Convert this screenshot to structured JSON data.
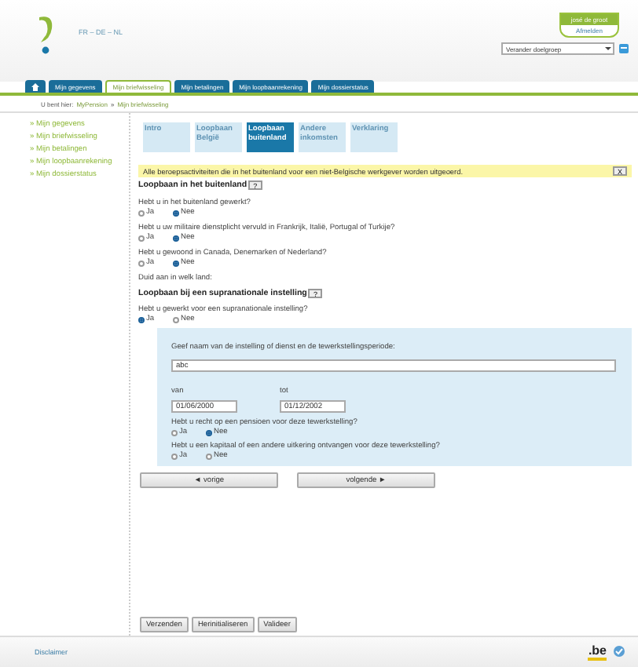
{
  "header": {
    "languages": "FR – DE – NL",
    "user": {
      "name": "josé de groot",
      "logout": "Afmelden"
    },
    "audience_select": {
      "value": "Verander doelgroep"
    }
  },
  "nav_tabs": [
    {
      "kind": "home",
      "selected": false
    },
    {
      "kind": "text",
      "label": "Mijn gegevens",
      "selected": false
    },
    {
      "kind": "text",
      "label": "Mijn briefwisseling",
      "selected": true
    },
    {
      "kind": "text",
      "label": "Mijn betalingen",
      "selected": false
    },
    {
      "kind": "text",
      "label": "Mijn loopbaanrekening",
      "selected": false
    },
    {
      "kind": "text",
      "label": "Mijn dossierstatus",
      "selected": false
    }
  ],
  "breadcrumb": {
    "prefix": "U bent hier:",
    "link": "MyPension",
    "separator": "»",
    "current": "Mijn briefwisseling"
  },
  "sidebar": {
    "items": [
      "» Mijn gegevens",
      "» Mijn briefwisseling",
      "» Mijn betalingen",
      "» Mijn loopbaanrekening",
      "» Mijn dossierstatus"
    ]
  },
  "steps": [
    {
      "label": "Intro",
      "selected": false
    },
    {
      "label": "Loopbaan België",
      "selected": false
    },
    {
      "label": "Loopbaan buitenland",
      "selected": true
    },
    {
      "label": "Andere inkomsten",
      "selected": false
    },
    {
      "label": "Verklaring",
      "selected": false
    }
  ],
  "notice": {
    "text": "Alle beroepsactiviteiten die in het buitenland voor een niet-Belgische werkgever worden uitgeoerd.",
    "close": "X"
  },
  "section_1": {
    "heading": "Loopbaan in het buitenland",
    "help": "?",
    "questions": [
      {
        "text": "Hebt u in het buitenland gewerkt?",
        "options": [
          {
            "label": "Ja",
            "selected": false
          },
          {
            "label": "Nee",
            "selected": true
          }
        ]
      },
      {
        "text": "Hebt u uw militaire dienstplicht vervuld in Frankrijk, Italië, Portugal of Turkije?",
        "options": [
          {
            "label": "Ja",
            "selected": false
          },
          {
            "label": "Nee",
            "selected": true
          }
        ]
      },
      {
        "text": "Hebt u gewoond in Canada, Denemarken of Nederland?",
        "options": [
          {
            "label": "Ja",
            "selected": false
          },
          {
            "label": "Nee",
            "selected": true
          }
        ]
      }
    ],
    "note": "Duid aan in welk land:"
  },
  "section_2": {
    "heading": "Loopbaan bij een supranationale instelling",
    "help": "?",
    "question": {
      "text": "Hebt u gewerkt voor een supranationale instelling?",
      "options": [
        {
          "label": "Ja",
          "selected": true
        },
        {
          "label": "Nee",
          "selected": false
        }
      ]
    },
    "panel": {
      "prompt": "Geef naam van de instelling of dienst en de tewerkstellingsperiode:",
      "name_value": "abc",
      "from_label": "van",
      "from_value": "01/06/2000",
      "to_label": "tot",
      "to_value": "01/12/2002",
      "questions": [
        {
          "text": "Hebt u recht op een pensioen voor deze tewerkstelling?",
          "options": [
            {
              "label": "Ja",
              "selected": false
            },
            {
              "label": "Nee",
              "selected": true
            }
          ]
        },
        {
          "text": "Hebt u een kapitaal of een andere uitkering ontvangen voor deze tewerkstelling?",
          "options": [
            {
              "label": "Ja",
              "selected": false
            },
            {
              "label": "Nee",
              "selected": false
            }
          ]
        }
      ]
    }
  },
  "step_buttons": {
    "previous": "◄ vorige",
    "next": "volgende ►"
  },
  "actions": [
    "Verzenden",
    "Herinitialiseren",
    "Valideer"
  ],
  "footer": {
    "disclaimer": "Disclaimer",
    "logo_text": ".be"
  }
}
